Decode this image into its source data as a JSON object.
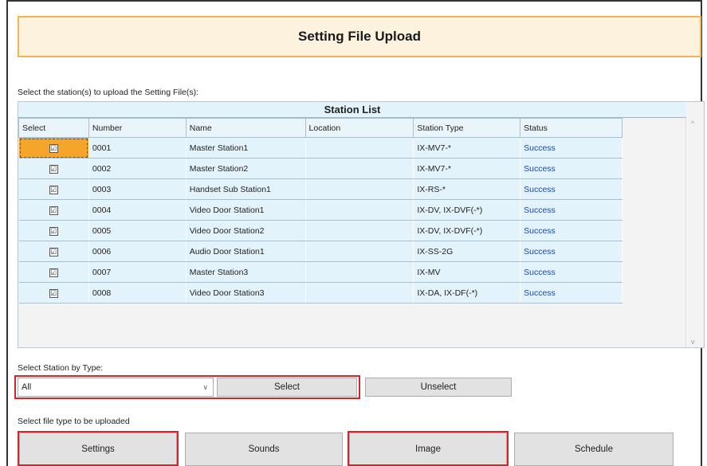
{
  "header": {
    "title": "Setting File Upload"
  },
  "instructions": {
    "select_stations": "Select the station(s) to upload the Setting File(s):",
    "select_by_type": "Select Station by Type:",
    "select_file_type": "Select file type to be uploaded"
  },
  "station_list": {
    "title": "Station List",
    "columns": [
      "Select",
      "Number",
      "Name",
      "Location",
      "Station Type",
      "Status"
    ],
    "rows": [
      {
        "checked": "☑",
        "number": "0001",
        "name": "Master Station1",
        "location": "",
        "type": "IX-MV7-*",
        "status": "Success"
      },
      {
        "checked": "☑",
        "number": "0002",
        "name": "Master Station2",
        "location": "",
        "type": "IX-MV7-*",
        "status": "Success"
      },
      {
        "checked": "☑",
        "number": "0003",
        "name": "Handset Sub Station1",
        "location": "",
        "type": "IX-RS-*",
        "status": "Success"
      },
      {
        "checked": "☑",
        "number": "0004",
        "name": "Video Door Station1",
        "location": "",
        "type": "IX-DV, IX-DVF(-*)",
        "status": "Success"
      },
      {
        "checked": "☑",
        "number": "0005",
        "name": "Video Door Station2",
        "location": "",
        "type": "IX-DV, IX-DVF(-*)",
        "status": "Success"
      },
      {
        "checked": "☑",
        "number": "0006",
        "name": "Audio Door Station1",
        "location": "",
        "type": "IX-SS-2G",
        "status": "Success"
      },
      {
        "checked": "☑",
        "number": "0007",
        "name": "Master Station3",
        "location": "",
        "type": "IX-MV",
        "status": "Success"
      },
      {
        "checked": "☑",
        "number": "0008",
        "name": "Video Door Station3",
        "location": "",
        "type": "IX-DA, IX-DF(-*)",
        "status": "Success"
      }
    ]
  },
  "type_select": {
    "value": "All"
  },
  "buttons": {
    "select": "Select",
    "unselect": "Unselect",
    "settings": "Settings",
    "sounds": "Sounds",
    "image": "Image",
    "schedule": "Schedule"
  },
  "colors": {
    "title_bg": "#fdf2de",
    "title_border": "#f4b454",
    "table_bg": "#e3f3fb",
    "status_text": "#1a47b0",
    "highlight": "#d9222a",
    "selected_cell": "#f5a52a"
  }
}
